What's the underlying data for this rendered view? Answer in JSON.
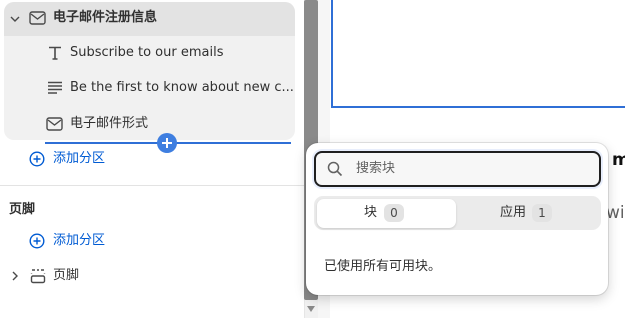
{
  "sidebar": {
    "section_title": "电子邮件注册信息",
    "blocks": [
      {
        "icon": "text-T-icon",
        "label": "Subscribe to our emails"
      },
      {
        "icon": "paragraph-lines-icon",
        "label": "Be the first to know about new c..."
      },
      {
        "icon": "email-envelope-icon",
        "label": "电子邮件形式"
      }
    ],
    "add_section_label": "添加分区",
    "footer_heading": "页脚",
    "footer_add_section_label": "添加分区",
    "footer_item_label": "页脚"
  },
  "popover": {
    "search_placeholder": "搜索块",
    "tabs": [
      {
        "label": "块",
        "count": "0"
      },
      {
        "label": "应用",
        "count": "1"
      }
    ],
    "empty_message": "已使用所有可用块。"
  },
  "preview": {
    "partial_heading": "mi",
    "partial_text": "wit"
  },
  "colors": {
    "accent": "#005bd3",
    "insert_line": "#2f6fd6"
  }
}
